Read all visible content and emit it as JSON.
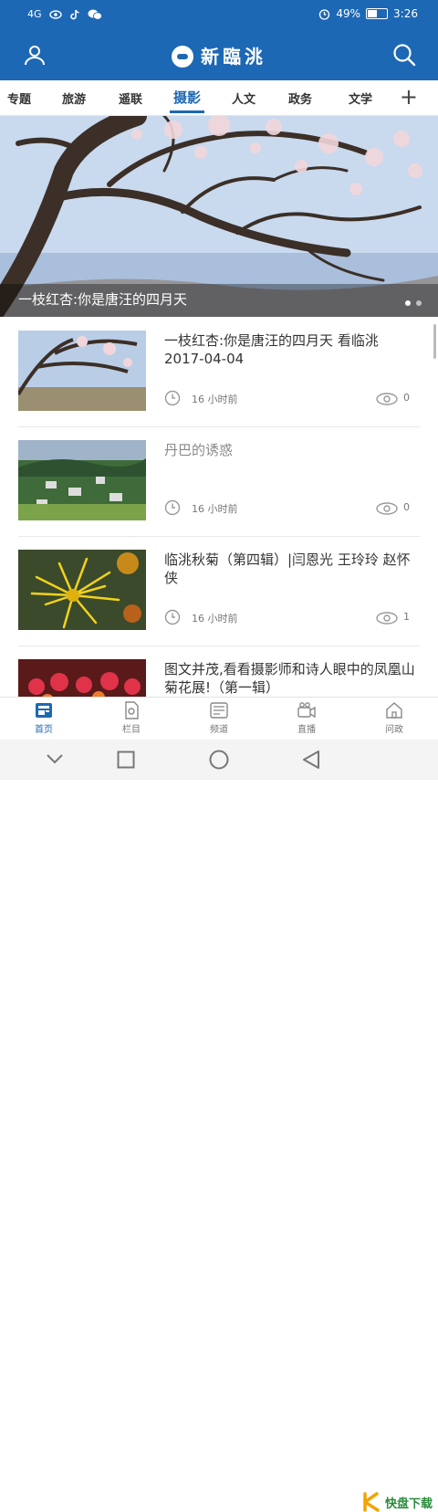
{
  "status": {
    "network": "4G",
    "battery": "49%",
    "time": "3:26"
  },
  "app": {
    "title": "新臨洮"
  },
  "tabs": [
    {
      "label": "专题"
    },
    {
      "label": "旅游"
    },
    {
      "label": "遥联"
    },
    {
      "label": "摄影"
    },
    {
      "label": "人文"
    },
    {
      "label": "政务"
    },
    {
      "label": "文学"
    }
  ],
  "tab_add": "+",
  "hero": {
    "caption": "一枝红杏:你是唐汪的四月天"
  },
  "articles": [
    {
      "title": "一枝红杏:你是唐汪的四月天 看临洮 2017-04-04",
      "time": "16 小时前",
      "views": "0"
    },
    {
      "title": "丹巴的诱惑",
      "time": "16 小时前",
      "views": "0"
    },
    {
      "title": "临洮秋菊（第四辑）|闫恩光 王玲玲 赵怀侠",
      "time": "16 小时前",
      "views": "1"
    },
    {
      "title": "图文并茂,看看摄影师和诗人眼中的凤凰山菊花展!（第一辑）",
      "time": "",
      "views": ""
    }
  ],
  "bottom_nav": [
    {
      "label": "首页"
    },
    {
      "label": "栏目"
    },
    {
      "label": "频道"
    },
    {
      "label": "直播"
    },
    {
      "label": "问政"
    }
  ],
  "watermark": {
    "text": "快盘下载"
  }
}
